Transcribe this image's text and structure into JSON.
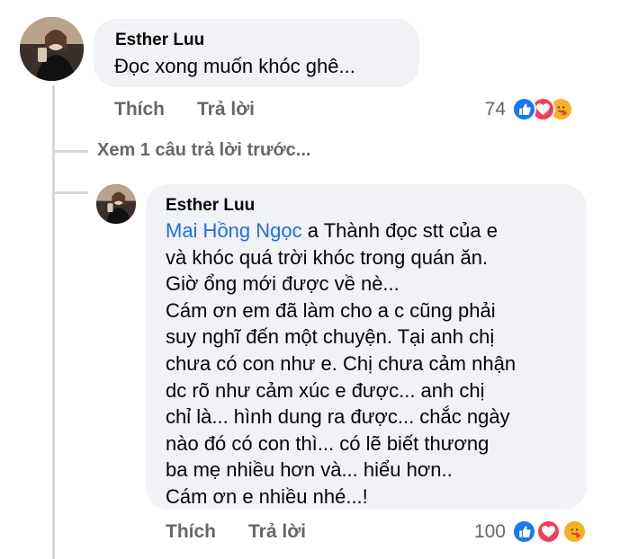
{
  "comment": {
    "author": "Esther Luu",
    "text": "Đọc xong muốn khóc ghê...",
    "like_label": "Thích",
    "reply_label": "Trả lời",
    "reaction_count": "74"
  },
  "view_previous": "Xem 1 câu trả lời trước...",
  "reply": {
    "author": "Esther Luu",
    "mention": "Mai Hồng Ngọc",
    "lines": [
      " a Thành đọc stt của e",
      "và khóc quá trời khóc trong quán ăn.",
      "Giờ ổng mới được về nè...",
      "Cám ơn em đã làm cho a c cũng phải",
      "suy nghĩ đến một chuyện. Tại anh chị",
      "chưa có con như e. Chị chưa cảm nhận",
      "dc rõ như cảm xúc e được... anh chị",
      "chỉ là... hình dung ra được... chắc ngày",
      "nào đó có con thì... có lẽ biết thương",
      "ba mẹ nhiều hơn và... hiểu hơn..",
      "Cám ơn e nhiều nhé...!"
    ],
    "like_label": "Thích",
    "reply_label": "Trả lời",
    "reaction_count": "100"
  },
  "colors": {
    "like": "#1877f2",
    "love": "#f33e58",
    "care": "#f7b125",
    "mention": "#216fdb",
    "secondary_text": "#65676b",
    "bubble": "#f0f2f5"
  }
}
